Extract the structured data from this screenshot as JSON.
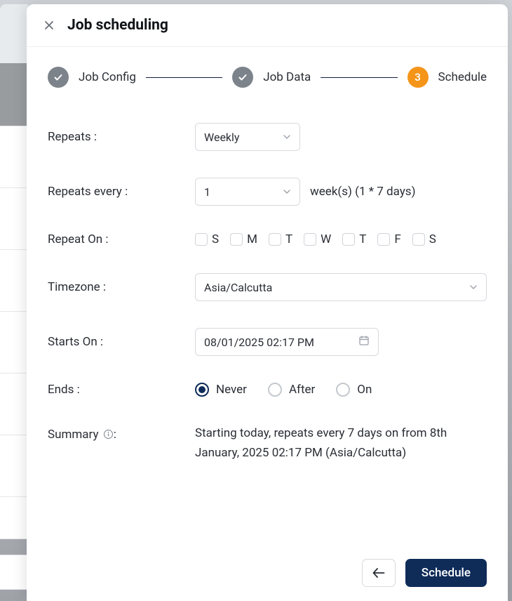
{
  "header": {
    "title": "Job scheduling"
  },
  "stepper": {
    "steps": [
      {
        "label": "Job Config",
        "state": "done"
      },
      {
        "label": "Job Data",
        "state": "done"
      },
      {
        "label": "Schedule",
        "state": "active",
        "number": "3"
      }
    ]
  },
  "form": {
    "repeats": {
      "label": "Repeats :",
      "value": "Weekly"
    },
    "repeats_every": {
      "label": "Repeats every :",
      "value": "1",
      "suffix": "week(s) (1 * 7 days)"
    },
    "repeat_on": {
      "label": "Repeat On :",
      "days": [
        "S",
        "M",
        "T",
        "W",
        "T",
        "F",
        "S"
      ]
    },
    "timezone": {
      "label": "Timezone :",
      "value": "Asia/Calcutta"
    },
    "starts_on": {
      "label": "Starts On :",
      "value": "08/01/2025 02:17 PM"
    },
    "ends": {
      "label": "Ends :",
      "options": [
        {
          "label": "Never",
          "checked": true
        },
        {
          "label": "After",
          "checked": false
        },
        {
          "label": "On",
          "checked": false
        }
      ]
    },
    "summary": {
      "label": "Summary ",
      "colon": ":",
      "text": "Starting today, repeats every 7 days on from 8th January, 2025 02:17 PM (Asia/Calcutta)"
    }
  },
  "footer": {
    "schedule_label": "Schedule"
  }
}
